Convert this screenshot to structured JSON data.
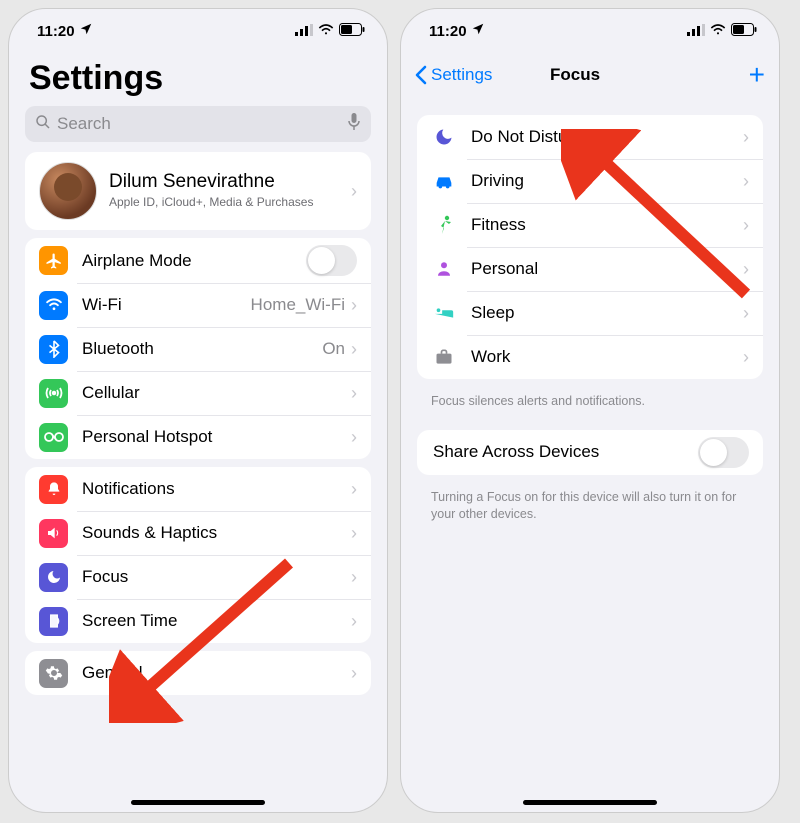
{
  "status": {
    "time": "11:20"
  },
  "left": {
    "title": "Settings",
    "search_placeholder": "Search",
    "profile": {
      "name": "Dilum Senevirathne",
      "subtitle": "Apple ID, iCloud+, Media & Purchases"
    },
    "group1": {
      "airplane": "Airplane Mode",
      "wifi": "Wi-Fi",
      "wifi_value": "Home_Wi-Fi",
      "bluetooth": "Bluetooth",
      "bluetooth_value": "On",
      "cellular": "Cellular",
      "hotspot": "Personal Hotspot"
    },
    "group2": {
      "notifications": "Notifications",
      "sounds": "Sounds & Haptics",
      "focus": "Focus",
      "screentime": "Screen Time"
    },
    "group3": {
      "general": "General"
    }
  },
  "right": {
    "back": "Settings",
    "title": "Focus",
    "items": {
      "dnd": "Do Not Disturb",
      "driving": "Driving",
      "fitness": "Fitness",
      "personal": "Personal",
      "sleep": "Sleep",
      "work": "Work"
    },
    "footer1": "Focus silences alerts and notifications.",
    "share": "Share Across Devices",
    "footer2": "Turning a Focus on for this device will also turn it on for your other devices."
  },
  "colors": {
    "orange": "#ff9500",
    "blue": "#007aff",
    "green": "#34c759",
    "green2": "#30d158",
    "red": "#ff3b30",
    "red2": "#ff375f",
    "indigo": "#5856d6",
    "gray": "#8e8e93",
    "teal": "#32d1c3",
    "purple": "#af52de"
  }
}
